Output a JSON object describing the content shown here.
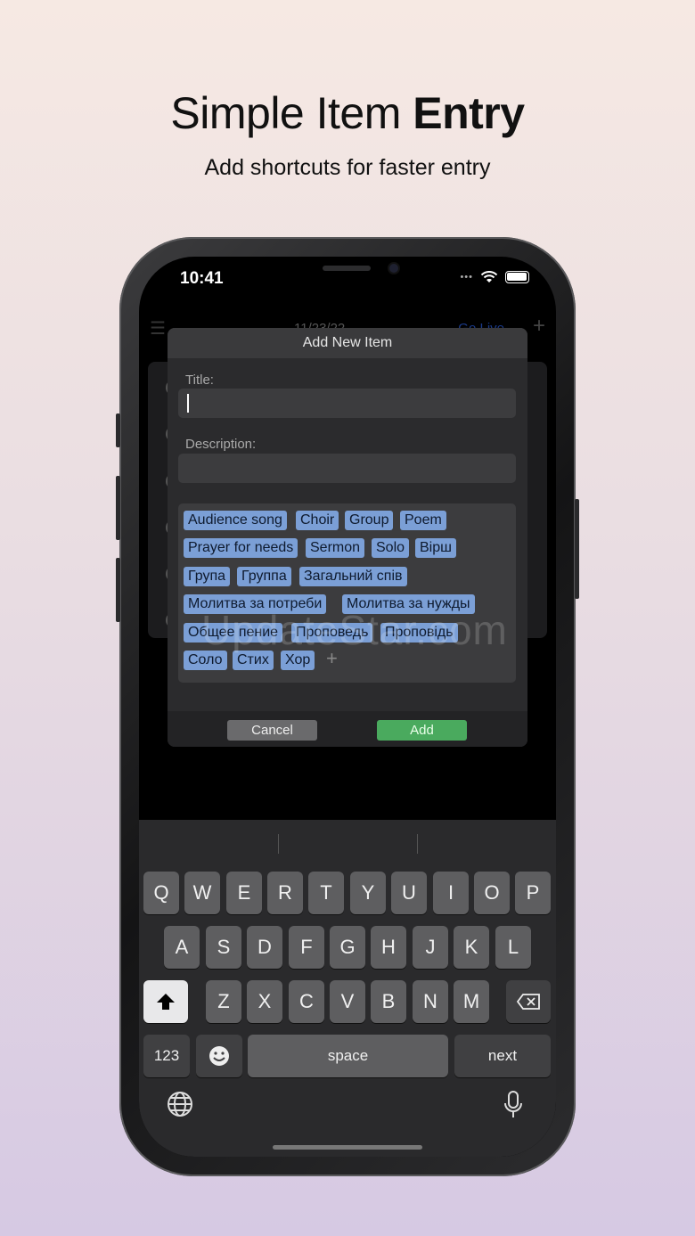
{
  "headline": {
    "normal": "Simple Item ",
    "bold": "Entry"
  },
  "subheadline": "Add shortcuts for faster entry",
  "status_bar": {
    "time": "10:41"
  },
  "background_app": {
    "date": "11/23/22",
    "go_live": "Go Live"
  },
  "dialog": {
    "title": "Add New Item",
    "title_label": "Title:",
    "title_value": "",
    "description_label": "Description:",
    "description_value": "",
    "tags": [
      "Audience song",
      "Choir",
      "Group",
      "Poem",
      "Prayer for needs",
      "Sermon",
      "Solo",
      "Вірш",
      "Група",
      "Группа",
      "Загальний спів",
      "Молитва за  потреби",
      "Молитва за нужды",
      "Общее пение",
      "Проповедь",
      "Проповідь",
      "Соло",
      "Стих",
      "Хор"
    ],
    "cancel_label": "Cancel",
    "add_label": "Add"
  },
  "watermark": "UpdateStar.com",
  "keyboard": {
    "row1": [
      "Q",
      "W",
      "E",
      "R",
      "T",
      "Y",
      "U",
      "I",
      "O",
      "P"
    ],
    "row2": [
      "A",
      "S",
      "D",
      "F",
      "G",
      "H",
      "J",
      "K",
      "L"
    ],
    "row3": [
      "Z",
      "X",
      "C",
      "V",
      "B",
      "N",
      "M"
    ],
    "numbers_label": "123",
    "space_label": "space",
    "next_label": "next"
  }
}
